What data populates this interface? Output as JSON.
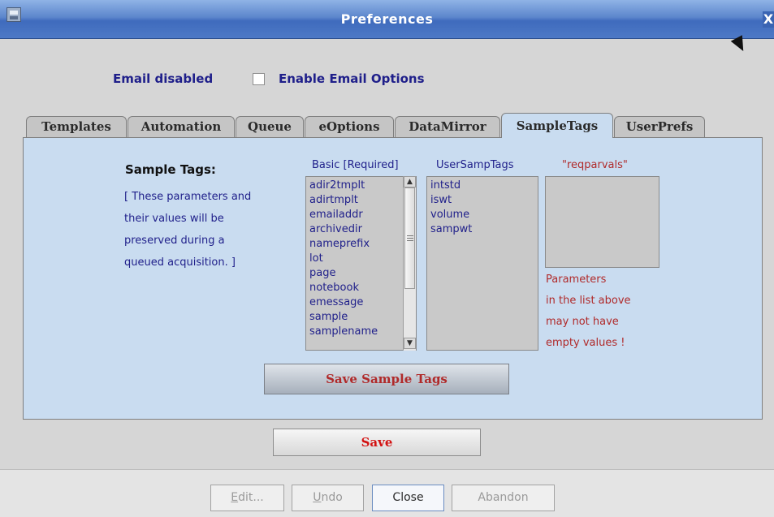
{
  "window": {
    "title": "Preferences",
    "close_label": "X"
  },
  "email": {
    "status": "Email disabled",
    "option_label": "Enable Email Options",
    "option_checked": false
  },
  "tabs": [
    {
      "label": "Templates",
      "active": false
    },
    {
      "label": "Automation",
      "active": false
    },
    {
      "label": "Queue",
      "active": false
    },
    {
      "label": "eOptions",
      "active": false
    },
    {
      "label": "DataMirror",
      "active": false
    },
    {
      "label": "SampleTags",
      "active": true
    },
    {
      "label": "UserPrefs",
      "active": false
    }
  ],
  "sample_tags": {
    "heading": "Sample Tags:",
    "note_lines": [
      "[ These parameters and",
      "their values will be",
      "preserved during a",
      "queued acquisition. ]"
    ],
    "basic": {
      "header": "Basic [Required]",
      "items": [
        "adir2tmplt",
        "adirtmplt",
        "emailaddr",
        "archivedir",
        "nameprefix",
        "lot",
        "page",
        "notebook",
        "emessage",
        "sample",
        "samplename"
      ]
    },
    "user": {
      "header": "UserSampTags",
      "items": [
        "intstd",
        "iswt",
        "volume",
        "sampwt"
      ]
    },
    "reqparvals": {
      "header": "\"reqparvals\"",
      "items": []
    },
    "warning_lines": [
      "Parameters",
      "in the list above",
      "may not have",
      "empty values !"
    ],
    "save_button": "Save Sample Tags"
  },
  "save_button": "Save",
  "footer": {
    "buttons": [
      {
        "label": "Edit...",
        "enabled": false
      },
      {
        "label": "Undo",
        "enabled": false
      },
      {
        "label": "Close",
        "enabled": true
      },
      {
        "label": "Abandon",
        "enabled": false
      }
    ]
  },
  "colors": {
    "title_bar": "#4d79c6",
    "panel": "#c9dcf0",
    "label_blue": "#1f1f8a",
    "warning_red": "#b02a2a"
  }
}
